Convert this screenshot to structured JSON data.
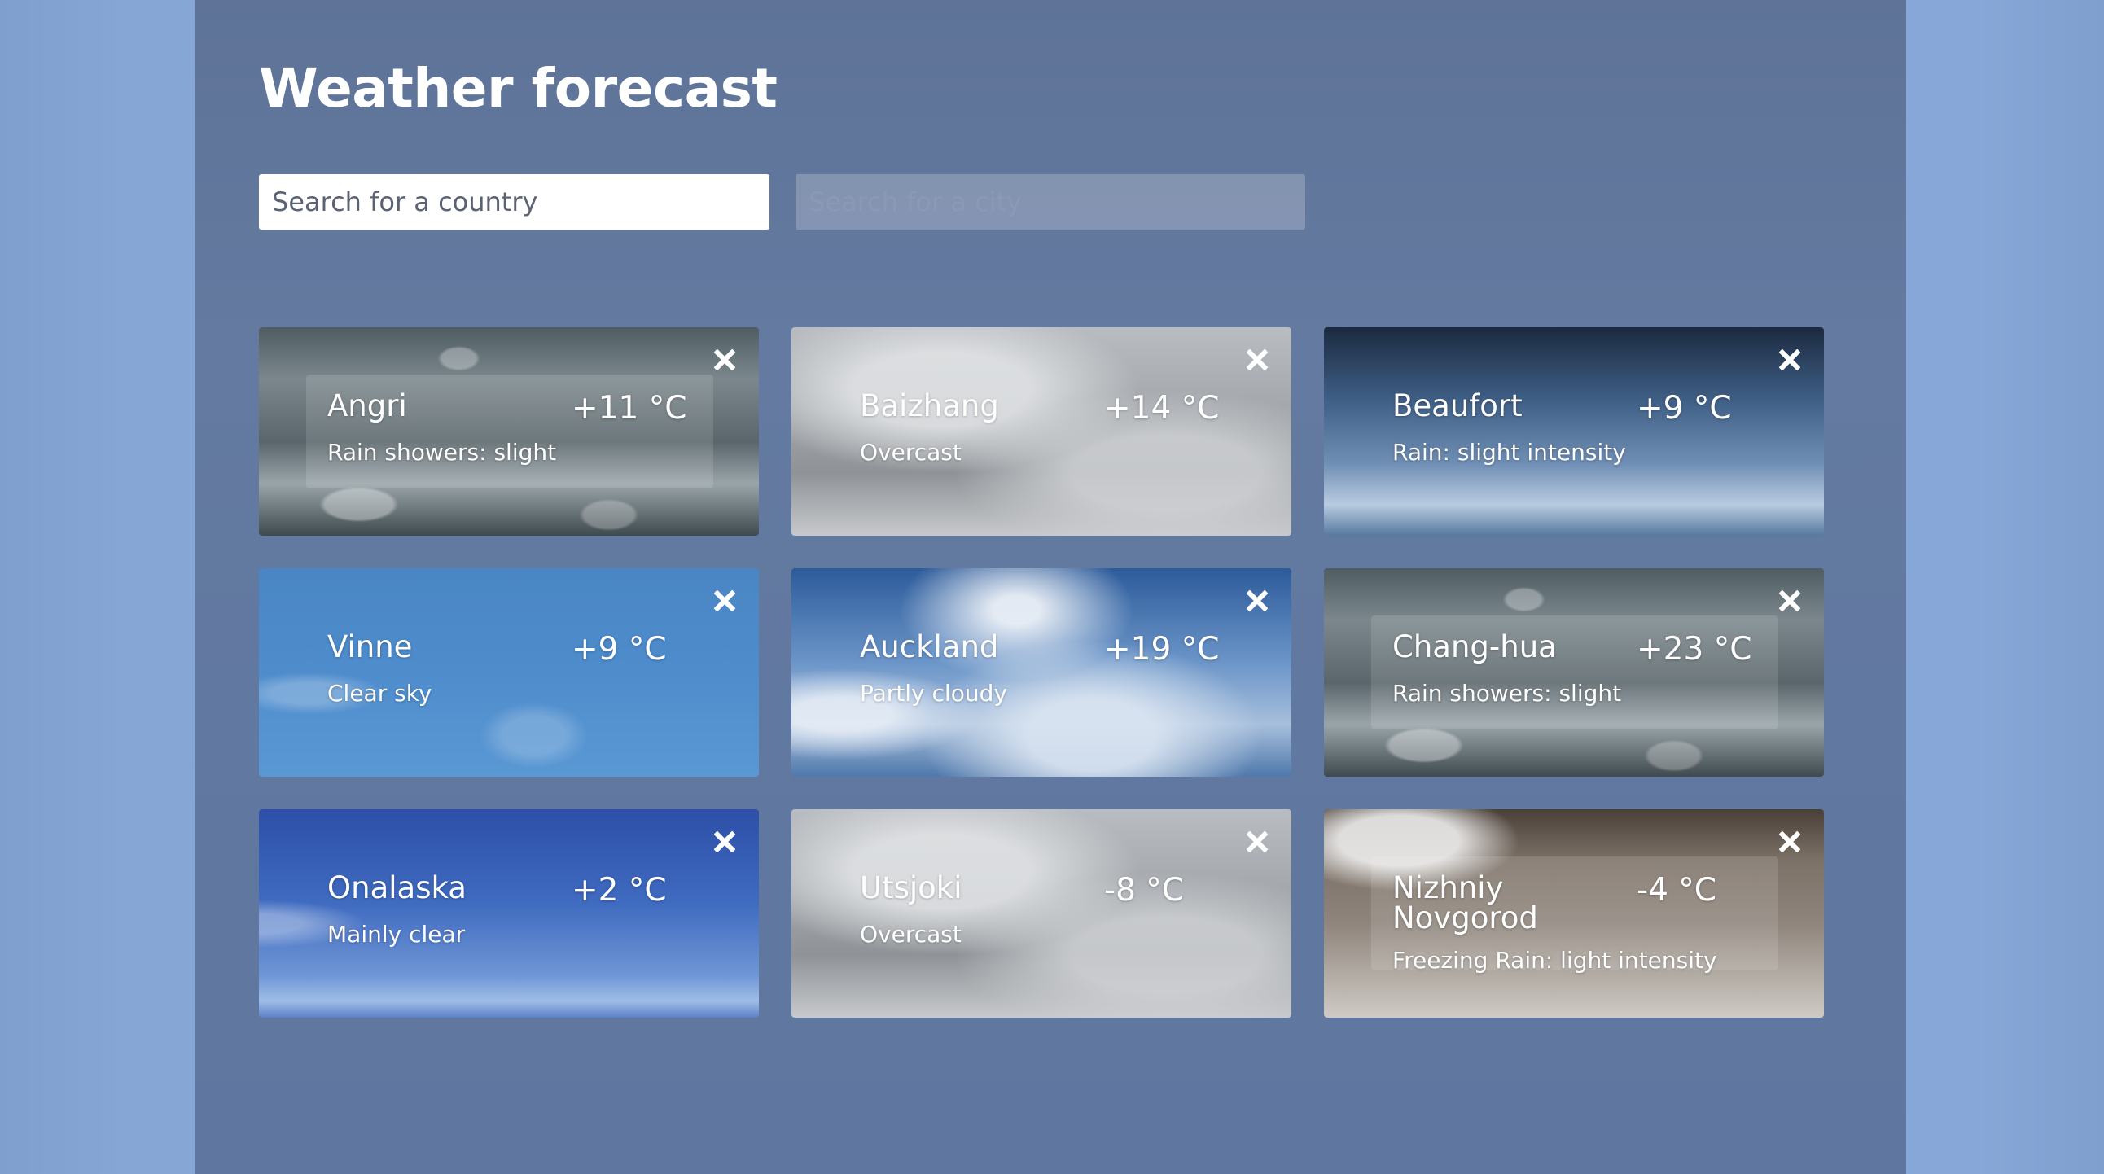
{
  "header": {
    "title": "Weather forecast"
  },
  "search": {
    "country_placeholder": "Search for a country",
    "city_placeholder": "Search for a city"
  },
  "cards": [
    {
      "city": "Angri",
      "temp": "+11 °C",
      "desc": "Rain showers: slight",
      "background": "rain"
    },
    {
      "city": "Baizhang",
      "temp": "+14 °C",
      "desc": "Overcast",
      "background": "overcast"
    },
    {
      "city": "Beaufort",
      "temp": "+9 °C",
      "desc": "Rain: slight intensity",
      "background": "slight-rain"
    },
    {
      "city": "Vinne",
      "temp": "+9 °C",
      "desc": "Clear sky",
      "background": "clear"
    },
    {
      "city": "Auckland",
      "temp": "+19 °C",
      "desc": "Partly cloudy",
      "background": "partly"
    },
    {
      "city": "Chang-hua",
      "temp": "+23 °C",
      "desc": "Rain showers: slight",
      "background": "rain"
    },
    {
      "city": "Onalaska",
      "temp": "+2 °C",
      "desc": "Mainly clear",
      "background": "mainly-clear"
    },
    {
      "city": "Utsjoki",
      "temp": "-8 °C",
      "desc": "Overcast",
      "background": "overcast"
    },
    {
      "city": "Nizhniy Novgorod",
      "temp": "-4 °C",
      "desc": "Freezing Rain: light intensity",
      "background": "freezing"
    }
  ],
  "icons": {
    "close": "close-icon"
  },
  "colors": {
    "page_background": "#87a7d8",
    "panel_background": "#6178a0",
    "text": "#ffffff"
  }
}
